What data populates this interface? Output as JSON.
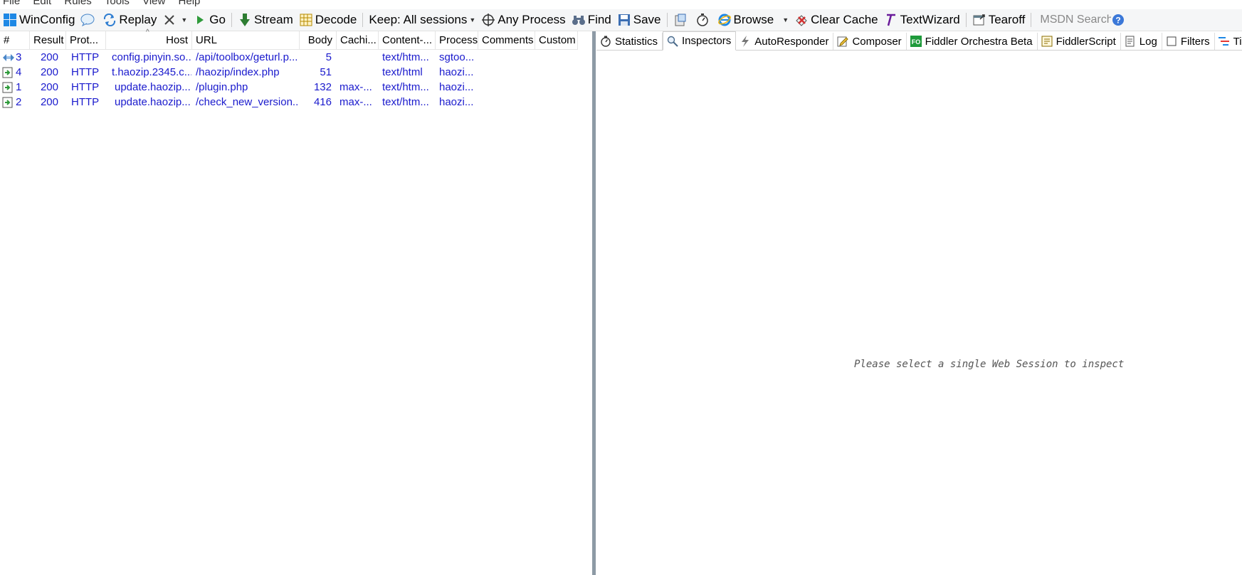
{
  "menu": [
    "File",
    "Edit",
    "Rules",
    "Tools",
    "View",
    "Help"
  ],
  "toolbar": {
    "winconfig": "WinConfig",
    "replay": "Replay",
    "go": "Go",
    "stream": "Stream",
    "decode": "Decode",
    "keep": "Keep: All sessions",
    "any_process": "Any Process",
    "find": "Find",
    "save": "Save",
    "browse": "Browse",
    "clear_cache": "Clear Cache",
    "textwizard": "TextWizard",
    "tearoff": "Tearoff",
    "msdn_search": "MSDN Search..."
  },
  "columns": [
    "#",
    "Result",
    "Prot...",
    "Host",
    "URL",
    "Body",
    "Cachi...",
    "Content-...",
    "Process",
    "Comments",
    "Custom"
  ],
  "sessions": [
    {
      "num": "3",
      "result": "200",
      "protocol": "HTTP",
      "host": "config.pinyin.so...",
      "url": "/api/toolbox/geturl.p...",
      "body": "5",
      "caching": "",
      "content_type": "text/htm...",
      "process": "sgtoo..."
    },
    {
      "num": "4",
      "result": "200",
      "protocol": "HTTP",
      "host": "t.haozip.2345.c...",
      "url": "/haozip/index.php",
      "body": "51",
      "caching": "",
      "content_type": "text/html",
      "process": "haozi..."
    },
    {
      "num": "1",
      "result": "200",
      "protocol": "HTTP",
      "host": "update.haozip....",
      "url": "/plugin.php",
      "body": "132",
      "caching": "max-...",
      "content_type": "text/htm...",
      "process": "haozi..."
    },
    {
      "num": "2",
      "result": "200",
      "protocol": "HTTP",
      "host": "update.haozip....",
      "url": "/check_new_version...",
      "body": "416",
      "caching": "max-...",
      "content_type": "text/htm...",
      "process": "haozi..."
    }
  ],
  "tabs": [
    "Statistics",
    "Inspectors",
    "AutoResponder",
    "Composer",
    "Fiddler Orchestra Beta",
    "FiddlerScript",
    "Log",
    "Filters",
    "Timeline"
  ],
  "active_tab": "Inspectors",
  "inspector_message": "Please select a single Web Session to inspect",
  "colors": {
    "session_text": "#1a1acd",
    "splitter": "#8d9aa5",
    "fo_badge": "#1f9a3b"
  }
}
